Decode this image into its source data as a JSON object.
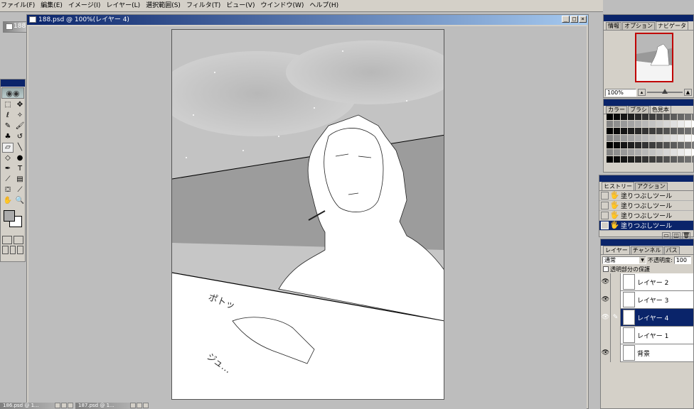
{
  "menu": [
    "ファイル(F)",
    "編集(E)",
    "イメージ(I)",
    "レイヤー(L)",
    "選択範囲(S)",
    "フィルタ(T)",
    "ビュー(V)",
    "ウインドウ(W)",
    "ヘルプ(H)"
  ],
  "bg_doc_title": "188",
  "doc": {
    "title": "188.psd @ 100%(レイヤー 4)",
    "min": "_",
    "max": "□",
    "close": "×"
  },
  "canvas_text": {
    "sfx1": "ポトッ",
    "sfx2": "ジュ…"
  },
  "toolbox": {
    "tools": [
      {
        "icon": "marquee-icon",
        "glyph": "⬚"
      },
      {
        "icon": "move-icon",
        "glyph": "✥"
      },
      {
        "icon": "lasso-icon",
        "glyph": "ℓ"
      },
      {
        "icon": "magic-wand-icon",
        "glyph": "✧"
      },
      {
        "icon": "airbrush-icon",
        "glyph": "✎"
      },
      {
        "icon": "paintbrush-icon",
        "glyph": "🖌"
      },
      {
        "icon": "stamp-icon",
        "glyph": "♣"
      },
      {
        "icon": "history-brush-icon",
        "glyph": "↺"
      },
      {
        "icon": "eraser-icon",
        "glyph": "▱"
      },
      {
        "icon": "pencil-icon",
        "glyph": "╲"
      },
      {
        "icon": "blur-icon",
        "glyph": "◇"
      },
      {
        "icon": "burn-icon",
        "glyph": "●"
      },
      {
        "icon": "pen-icon",
        "glyph": "✒"
      },
      {
        "icon": "type-icon",
        "glyph": "T"
      },
      {
        "icon": "measure-icon",
        "glyph": "⟋"
      },
      {
        "icon": "gradient-icon",
        "glyph": "▤"
      },
      {
        "icon": "paint-bucket-icon",
        "glyph": "⛋"
      },
      {
        "icon": "eyedropper-icon",
        "glyph": "⟋"
      },
      {
        "icon": "hand-icon",
        "glyph": "✋"
      },
      {
        "icon": "zoom-icon",
        "glyph": "🔍"
      }
    ],
    "fg_color": "#ababab",
    "bg_color": "#ffffff"
  },
  "navigator": {
    "tabs": [
      "情報",
      "オプション",
      "ナビゲータ"
    ],
    "active_tab": 2,
    "zoom": "100%"
  },
  "swatches_panel": {
    "tabs": [
      "カラー",
      "ブラシ",
      "色見本"
    ],
    "active_tab": 2
  },
  "history": {
    "tabs": [
      "ヒストリー",
      "アクション"
    ],
    "active_tab": 0,
    "items": [
      "塗りつぶしツール",
      "塗りつぶしツール",
      "塗りつぶしツール",
      "塗りつぶしツール"
    ],
    "selected": 3
  },
  "layers": {
    "tabs": [
      "レイヤー",
      "チャンネル",
      "パス"
    ],
    "active_tab": 0,
    "blend_mode": "通常",
    "opacity_label": "不透明度:",
    "opacity": "100",
    "preserve_label": "透明部分の保護",
    "items": [
      {
        "name": "レイヤー 2",
        "visible": true
      },
      {
        "name": "レイヤー 3",
        "visible": true
      },
      {
        "name": "レイヤー 4",
        "visible": true
      },
      {
        "name": "レイヤー 1",
        "visible": false
      },
      {
        "name": "背景",
        "visible": true
      }
    ],
    "selected": 2
  },
  "taskbar": [
    "186.psd @ 1...",
    "187.psd @ 1..."
  ]
}
